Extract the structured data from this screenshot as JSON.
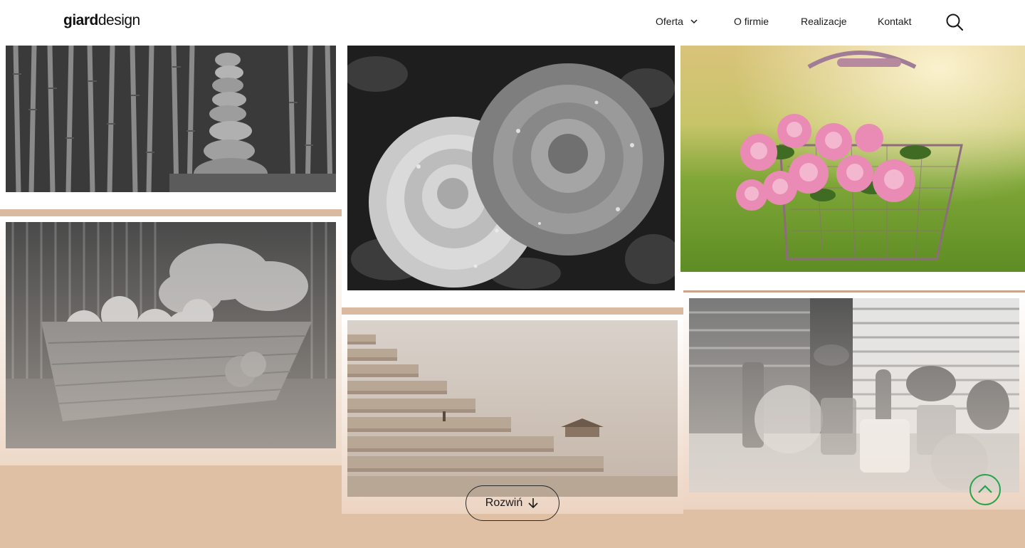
{
  "header": {
    "logo_bold": "giard",
    "logo_light": "design"
  },
  "nav": {
    "oferta": "Oferta",
    "firma": "O firmie",
    "realizacje": "Realizacje",
    "kontakt": "Kontakt"
  },
  "gallery": {
    "expand_label": "Rozwiń"
  },
  "colors": {
    "accent": "#e0c0a4",
    "scroll_top_ring": "#27a34a"
  },
  "icons": {
    "dropdown": "chevron-down-icon",
    "search": "search-icon",
    "expand": "arrow-down-icon",
    "scroll_top": "chevron-up-icon"
  }
}
